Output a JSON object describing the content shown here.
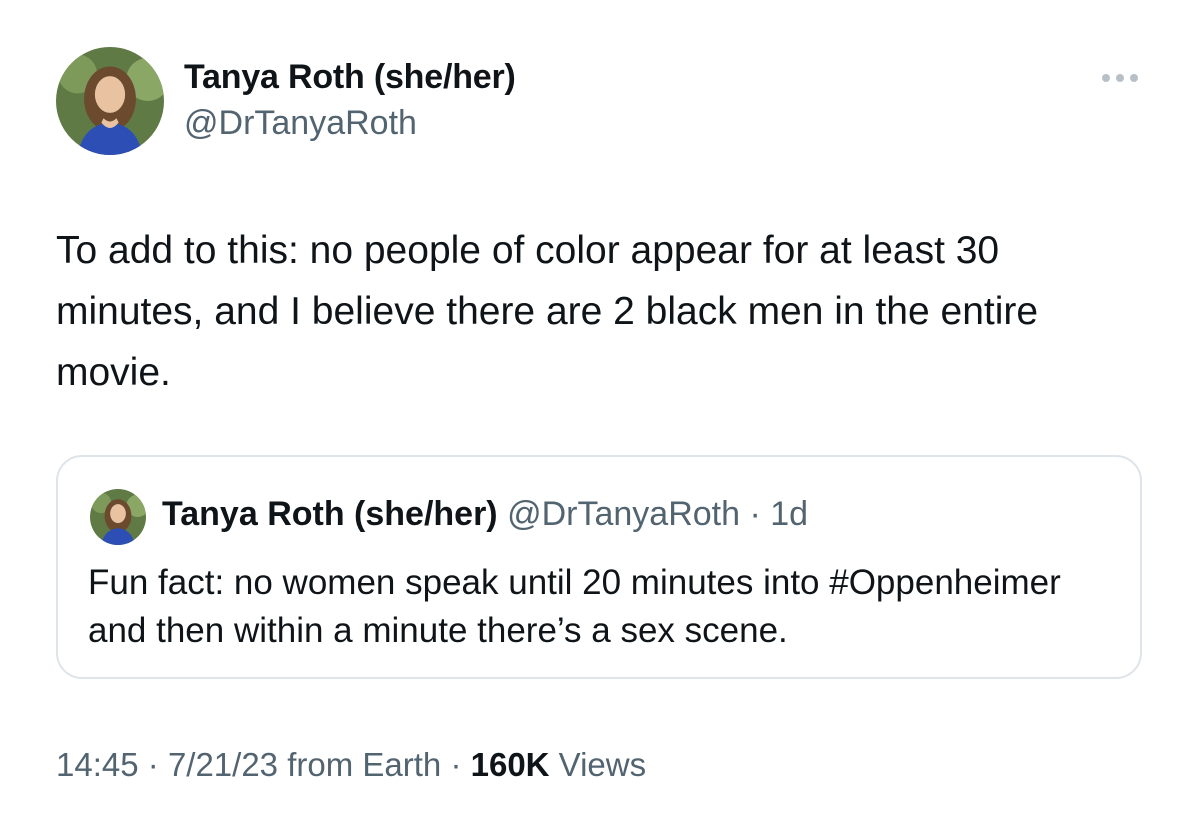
{
  "tweet": {
    "author": {
      "display_name": "Tanya Roth (she/her)",
      "handle": "@DrTanyaRoth",
      "avatar_icon": "profile-photo"
    },
    "more_icon": "more-horizontal-icon",
    "text": "To add to this: no people of color appear for at least 30 minutes, and I believe there are 2 black men in the entire movie.",
    "quote": {
      "display_name": "Tanya Roth (she/her)",
      "handle": "@DrTanyaRoth",
      "separator": "·",
      "time": "1d",
      "text": "Fun fact: no women speak until 20 minutes into #Oppenheimer and then within a minute there’s a sex scene."
    },
    "meta": {
      "time": "14:45",
      "sep1": "·",
      "date": "7/21/23",
      "source": "from Earth",
      "sep2": "·",
      "views_count": "160K",
      "views_label": "Views"
    }
  },
  "colors": {
    "text_primary": "#0f1419",
    "text_secondary": "#536471",
    "border": "#dfe4e8",
    "background": "#ffffff"
  }
}
